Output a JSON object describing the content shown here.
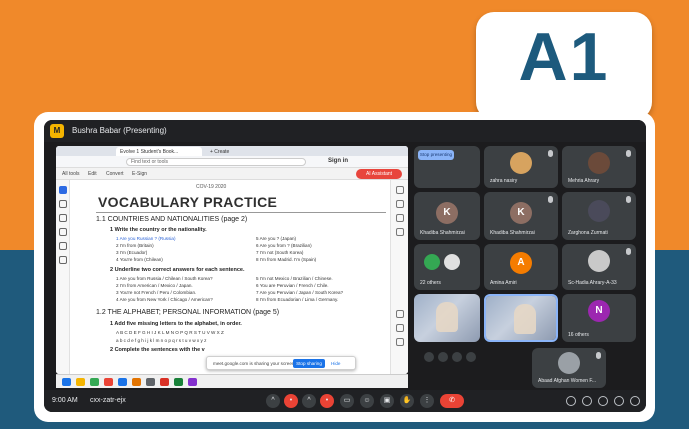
{
  "badge": {
    "text": "A1"
  },
  "meet": {
    "presenter_label": "Bushra Babar (Presenting)",
    "time": "9:00 AM",
    "meeting_code": "cxx-zatr-ejx",
    "presenting_chip": "Stop presenting",
    "participants": [
      {
        "name": "zahra nasiry"
      },
      {
        "name": "Mehria Ahrary"
      },
      {
        "name": "Khadiba Shahmirzai",
        "initial": "K"
      },
      {
        "name": "Khadiba Shahmirzai",
        "initial": "K"
      },
      {
        "name": "Zarghona Zurmati"
      },
      {
        "name": "22 others"
      },
      {
        "name": "Amina Amiri",
        "initial": "A"
      },
      {
        "name": "Sc-Hadia Ahrary-A-33"
      },
      {
        "name": "16 others",
        "initial": "N"
      },
      {
        "name": "Abaad Afghan Women F..."
      }
    ],
    "colors": {
      "accent_red": "#ea4335",
      "blue": "#1a73e8"
    }
  },
  "browser": {
    "tab_title": "Evolve 1 Student's Book...",
    "new_tab": "+ Create",
    "url": "Find text or tools",
    "signin": "Sign in",
    "toolbar": [
      "All tools",
      "Edit",
      "Convert",
      "E-Sign"
    ],
    "addin": "AI Assistant"
  },
  "document": {
    "cov": "COV-19 2020",
    "title": "VOCABULARY PRACTICE",
    "s1": "1.1   COUNTRIES AND NATIONALITIES (page 2)",
    "s1a": "1    Write the country or the nationality.",
    "s1_rows": [
      "1  Are you  Russian  ?   (Russia)",
      "2  I'm from              (Britain)",
      "3  I'm                      (Ecuador)",
      "4  You're from           (Chilean)",
      "5  Are you              ?  (Japan)",
      "6  Are you from          ?  (Brazilian)",
      "7  I'm not                  (South Korea)",
      "8  I'm from Madrid. I'm         (Spain)"
    ],
    "s1b": "2    Underline two correct answers for each sentence.",
    "s1b_rows": [
      "1  Are you from Russia / Chilean / South Korea?",
      "2  I'm from American / Mexico / Japan.",
      "3  You're not French / Peru / Colombian.",
      "4  Are you from New York / Chicago / American?",
      "5  I'm not Mexico / Brazilian / Chinese.",
      "6  You are Peruvian / French / Chile.",
      "7  Are you Peruvian / Japan / South Korea?",
      "8  I'm from Ecuadorian / Lima / Germany."
    ],
    "s2": "1.2   THE ALPHABET; PERSONAL INFORMATION (page 5)",
    "s2a": "1    Add five missing letters to the alphabet, in order.",
    "s2_alpha_upper": "A B C D E F G H I J K L M N O P Q R S T U V W X Z",
    "s2_alpha_lower": "a b c d e f g h i j k l m n o p q r s t u v w x y z",
    "s2b": "2    Complete the sentences with the v"
  },
  "share_popup": {
    "message": "meet.google.com is sharing your screen.",
    "stop": "Stop sharing",
    "hide": "Hide"
  }
}
